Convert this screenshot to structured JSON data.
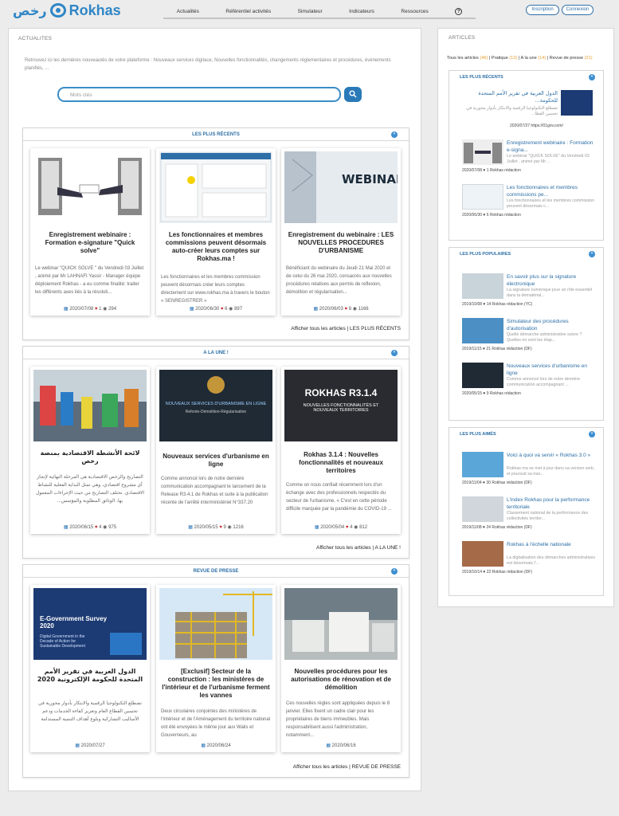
{
  "header": {
    "logo_ar": "رخص",
    "logo_en": "Rokhas",
    "nav": [
      "Actualités",
      "Référentiel activités",
      "Simulateur",
      "Indicateurs",
      "Ressources"
    ],
    "help_label": "?",
    "inscription": "Inscription",
    "connexion": "Connexion"
  },
  "main": {
    "title": "ACTUALITES",
    "intro": "Retrouvez ici les dernières nouveautés de votre plateforme : Nouveaux services digitaux, Nouvelles fonctionnalités, changements réglementaires et procédures, événements planifiés, ...",
    "search_placeholder": "Mots clés",
    "sections": [
      {
        "title": "LES PLUS RÉCENTS",
        "more": "Afficher tous les articles | LES PLUS RÉCENTS",
        "cards": [
          {
            "title": "Enregistrement webinaire : Formation e-signature \"Quick solve\"",
            "desc": "Le webinar \"QUICK SOLVE \" du Vendredi 03 Juillet , animé par Mr LAHNAFI Yassir - Manager équipe déploiement Rokhas - a eu comme finalité: traiter les différents axes liés à la résoluti...",
            "date": "2020/07/08",
            "likes": "1",
            "views": "294"
          },
          {
            "title": "Les fonctionnaires et membres commissions peuvent désormais auto-créer leurs comptes sur Rokhas.ma !",
            "desc": "Les fonctionnaires et les membres commission peuvent désormais créer leurs comptes directement sur www.rokhas.ma à travers le bouton « SENREGISTRER »",
            "date": "2020/06/30",
            "likes": "6",
            "views": "897"
          },
          {
            "title": "Enregistrement du webinaire : LES NOUVELLES PROCEDURES D'URBANISME",
            "desc": "Bénéficiant du webinaire du Jeudi 21 Mai 2020 et de celui du 26 mai 2020, consacrés aux nouvelles procédures relatives aux permis de reflexion, démolition et régularisation...",
            "date": "2020/06/03",
            "likes": "8",
            "views": "1166",
            "img_text": "WEBINAR"
          }
        ]
      },
      {
        "title": "A LA UNE !",
        "more": "Afficher tous les articles | A LA UNE !",
        "cards": [
          {
            "title": "لائحة الأنشطة الاقتصادية بمنصة رخص",
            "desc": "التصاريح والرخص الاقتصادية هي المرحلة النهائية لإنجاز أي مشروع اقتصادي، وهي تمثل البداية الفعلية للنشاط الاقتصادي. تختلف التصاريح من حيث الإجراءات المعمول بها، الوثائق المطلوبة والمؤسس...",
            "date": "2020/06/15",
            "likes": "4",
            "views": "975"
          },
          {
            "title": "Nouveaux services d'urbanisme en ligne",
            "desc": "Comme annoncé lors de notre dernière communication accompagnant le lancement de la Release R3.4.1 de Rokhas et suite à la publication récente de l'arrêté interministériel N°337.20",
            "date": "2020/05/15",
            "likes": "9",
            "views": "1216",
            "img_text": "NOUVEAUX SERVICES D'URBANISME EN LIGNE",
            "img_sub": "Refonte-Démolition-Régularisation"
          },
          {
            "title": "Rokhas 3.1.4 : Nouvelles fonctionnalités et nouveaux territoires",
            "desc": "Comme on nous confiait récemment lors d'un échange avec des professionnels respectés du secteur de l'urbanisme, « C'est en cette période difficile marquée par la pandémie du COVID-19 ...",
            "date": "2020/05/04",
            "likes": "4",
            "views": "812",
            "img_text": "ROKHAS R3.1.4",
            "img_sub": "NOUVELLES FONCTIONNALITÉS ET NOUVEAUX TERRITOIRES"
          }
        ]
      },
      {
        "title": "REVUE DE PRESSE",
        "more": "Afficher tous les articles | REVUE DE PRESSE",
        "cards": [
          {
            "title": "الدول العربية في تقرير الأمم المتحدة للحكومة الإلكترونية 2020",
            "desc": "تضطلع التكنولوجيا الرقمية والابتكار بأدوار محورية في تحسين القطاع العام وتعزيز كفاءة الخدمات ودعم الأساليب التشاركية وبلوغ أهداف التنمية المستدامة",
            "date": "2020/07/27",
            "img_text": "E-Government Survey 2020",
            "img_sub": "Digital Government in the Decade of Action for Sustainable Development"
          },
          {
            "title": "[Exclusif] Secteur de la construction : les ministères de l'intérieur et de l'urbanisme ferment les vannes",
            "desc": "Deux circulaires conjointes des ministères de l'intérieur et de l'Aménagement du territoire national ont été envoyées le même jour aux Walis et Gouverneurs, au",
            "date": "2020/06/24"
          },
          {
            "title": "Nouvelles procédures pour les autorisations de rénovation et de démolition",
            "desc": "Ces nouvelles règles sont appliquées depuis le 8 janvier. Elles fixent un cadre clair pour les propriétaires de biens immeubles. Mais responsabilisent aussi l'administration, notamment...",
            "date": "2020/06/16"
          }
        ]
      }
    ]
  },
  "side": {
    "title": "ARTICLES",
    "filters": [
      {
        "label": "Tous les articles",
        "count": "(46)"
      },
      {
        "label": "Pratique",
        "count": "(13)"
      },
      {
        "label": "A la une",
        "count": "(14)"
      },
      {
        "label": "Revue de presse",
        "count": "(21)"
      }
    ],
    "boxes": [
      {
        "title": "LES PLUS RÉCENTS",
        "items": [
          {
            "title": "الدول العربية في تقرير الأمم المتحدة للحكومة...",
            "desc": "تضطلع التكنولوجيا الرقمية والابتكار بأدوار محورية في تحسين القطا...",
            "meta": "2020/07/27 https://01gov.com/",
            "rtl": true
          },
          {
            "title": "Enregistrement webinaire : Formation e-signa...",
            "desc": "Le webinar \"QUICK SOLVE\" du Vendredi 03 Juillet , animé par Mr ...",
            "meta": "2020/07/08 ♥ 1 Rokhas rédaction"
          },
          {
            "title": "Les fonctionnaires et membres commissions pe...",
            "desc": "Les fonctionnaires et les membres commission peuvent désormais c...",
            "meta": "2020/06/30 ♥ 6 Rokhas rédaction"
          }
        ]
      },
      {
        "title": "LES PLUS POPULAIRES",
        "items": [
          {
            "title": "En savoir plus sur la signature électronique",
            "desc": "La signature numérique joue un rôle essentiel dans la dématérial...",
            "meta": "2019/10/08 ♥ 14 Rokhas rédaction (YC)"
          },
          {
            "title": "Simulateur des procédures d'autorisation",
            "desc": "Quelle démarche administrative suivre ? Quelles en sont les étap...",
            "meta": "2019/11/15 ♥ 21 Rokhas rédaction (DF)"
          },
          {
            "title": "Nouveaux services d'urbanisme en ligne",
            "desc": "Comme annoncé lors de notre dernière communication accompagnant ...",
            "meta": "2020/05/15 ♥ 9 Rokhas rédaction"
          }
        ]
      },
      {
        "title": "LES PLUS AIMÉS",
        "items": [
          {
            "title": "Voici à quoi va servir « Rokhas 3.0 »",
            "desc": "Rokhas ma se met à jour dans sa version web, et poursuit sa tran...",
            "meta": "2019/11/04 ♥ 30 Rokhas rédaction (DF)"
          },
          {
            "title": "L'index Rokhas pour la performance territoriale",
            "desc": "Classement national de la performance des collectivités territor...",
            "meta": "2019/11/08 ♥ 24 Rokhas rédaction (DF)"
          },
          {
            "title": "Rokhas à l'échelle nationale",
            "desc": "La digitalisation des démarches administratives est désormais l'...",
            "meta": "2019/10/14 ♥ 22 Rokhas rédaction (DF)"
          }
        ]
      }
    ]
  },
  "colors": {
    "accent": "#2f86c6",
    "heart": "#c8222a",
    "link": "#2b6ea6"
  }
}
